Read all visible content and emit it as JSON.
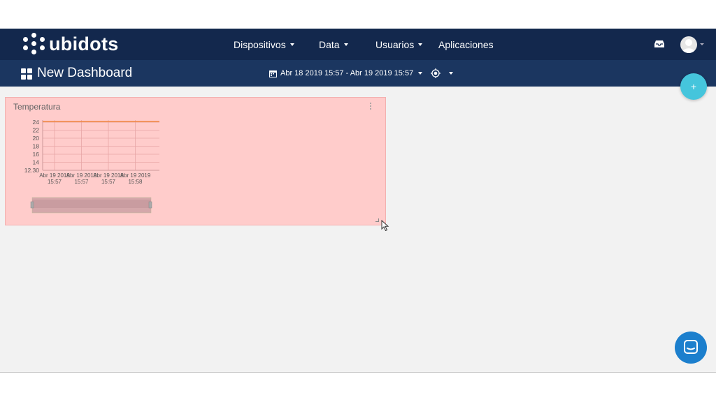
{
  "app": {
    "logo_text": "ubidots"
  },
  "nav": {
    "items": [
      {
        "label": "Dispositivos",
        "has_caret": true
      },
      {
        "label": "Data",
        "has_caret": true
      },
      {
        "label": "Usuarios",
        "has_caret": true
      },
      {
        "label": "Aplicaciones",
        "has_caret": false
      }
    ],
    "icons": [
      "inbox-icon",
      "avatar",
      "chevron-down-icon"
    ]
  },
  "dashboard": {
    "title": "New Dashboard",
    "date_range": "Abr 18 2019 15:57 - Abr 19 2019 15:57",
    "icons": [
      "dashboard-grid-icon",
      "calendar-icon",
      "chevron-down-icon",
      "realtime-icon"
    ]
  },
  "fab": {
    "label": "+"
  },
  "widget": {
    "title": "Temperatura",
    "background": "#ffcccb"
  },
  "chart_data": {
    "type": "line",
    "title": "Temperatura",
    "y_ticks": [
      "24",
      "22",
      "20",
      "18",
      "16",
      "14",
      "12.30"
    ],
    "x_ticks": [
      {
        "date": "Abr 19 2019",
        "time": "15:57"
      },
      {
        "date": "Abr 19 2019",
        "time": "15:57"
      },
      {
        "date": "Abr 19 2019",
        "time": "15:57"
      },
      {
        "date": "Abr 19 2019",
        "time": "15:58"
      }
    ],
    "series": [
      {
        "values": [
          24.6,
          24.6,
          24.6,
          24.6,
          24.6
        ]
      }
    ],
    "ylim": [
      12.3,
      25
    ],
    "grid": true,
    "line_color": "#f08a4b"
  },
  "colors": {
    "topbar": "#13284d",
    "subbar": "#1b3660",
    "accent": "#45c5dc",
    "chat": "#1c7fcd"
  }
}
